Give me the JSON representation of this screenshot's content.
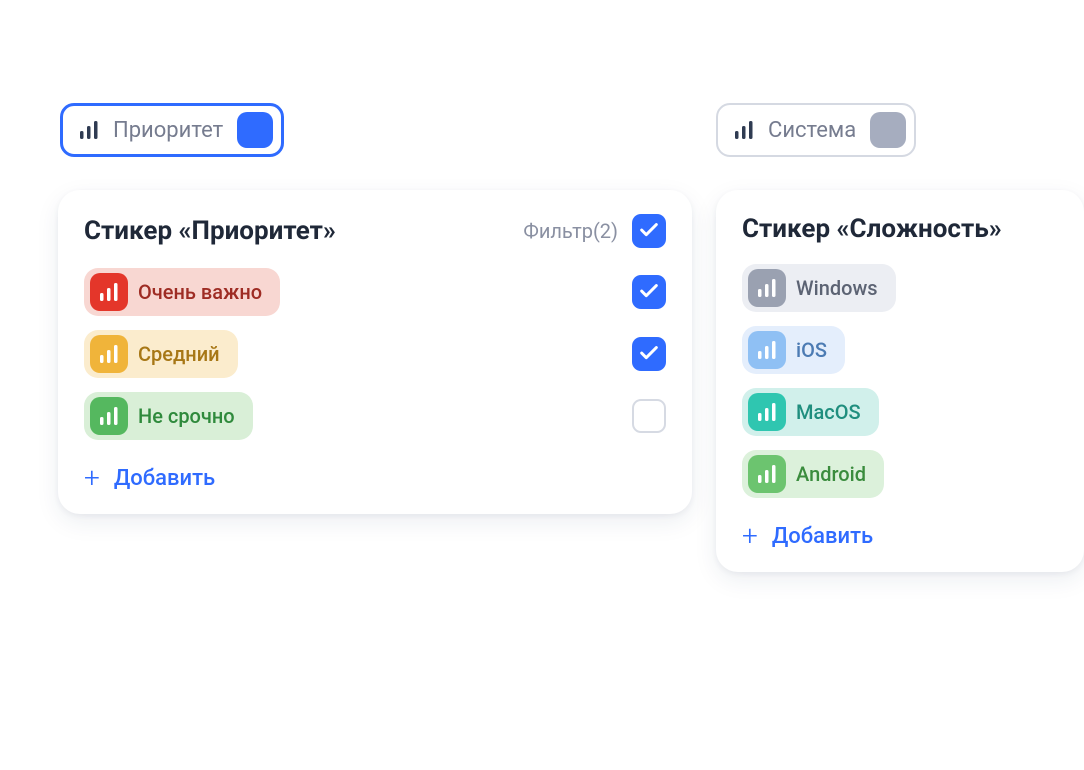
{
  "chips": {
    "priority": {
      "label": "Приоритет"
    },
    "system": {
      "label": "Система"
    }
  },
  "cards": {
    "priority": {
      "title": "Стикер «Приоритет»",
      "filter_label": "Фильтр(2)",
      "add_label": "Добавить",
      "tags": [
        {
          "label": "Очень важно",
          "icon_color": "#e4362a",
          "pill_bg": "#f8d7d2",
          "text_color": "#9e2c24",
          "checked": true
        },
        {
          "label": "Средний",
          "icon_color": "#f0b43a",
          "pill_bg": "#fbeccd",
          "text_color": "#a77716",
          "checked": true
        },
        {
          "label": "Не срочно",
          "icon_color": "#55b85f",
          "pill_bg": "#d9efd7",
          "text_color": "#2f8a3c",
          "checked": false
        }
      ]
    },
    "system": {
      "title": "Стикер «Сложность»",
      "add_label": "Добавить",
      "tags": [
        {
          "label": "Windows",
          "icon_color": "#9aa1b1",
          "pill_bg": "#eceef3",
          "text_color": "#5c6373"
        },
        {
          "label": "iOS",
          "icon_color": "#8fc0f4",
          "pill_bg": "#e4eefc",
          "text_color": "#4c7bb3"
        },
        {
          "label": "MacOS",
          "icon_color": "#2fc6b0",
          "pill_bg": "#d1f0eb",
          "text_color": "#1f8e7e"
        },
        {
          "label": "Android",
          "icon_color": "#6cc46f",
          "pill_bg": "#dcf1db",
          "text_color": "#3a8c3d"
        }
      ]
    }
  }
}
